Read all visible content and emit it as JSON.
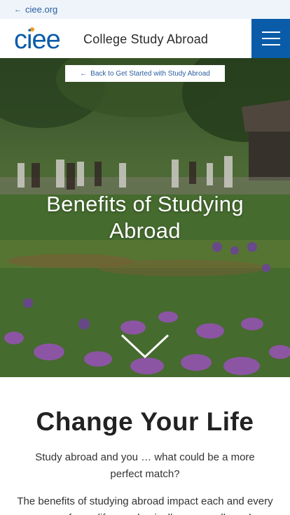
{
  "topbar": {
    "back_label": "ciee.org"
  },
  "header": {
    "logo_text": "ciee",
    "title": "College Study Abroad"
  },
  "hero": {
    "back_link_label": "Back to Get Started with Study Abroad",
    "title": "Benefits of Studying Abroad"
  },
  "content": {
    "heading": "Change Your Life",
    "para1": "Study abroad and you … what could be a more perfect match?",
    "para2": "The benefits of studying abroad impact each and every area of your life, academically, personally and"
  },
  "colors": {
    "brand_blue": "#0a5ca9",
    "link_blue": "#2a5d9f",
    "logo_orange": "#f39a1d"
  }
}
